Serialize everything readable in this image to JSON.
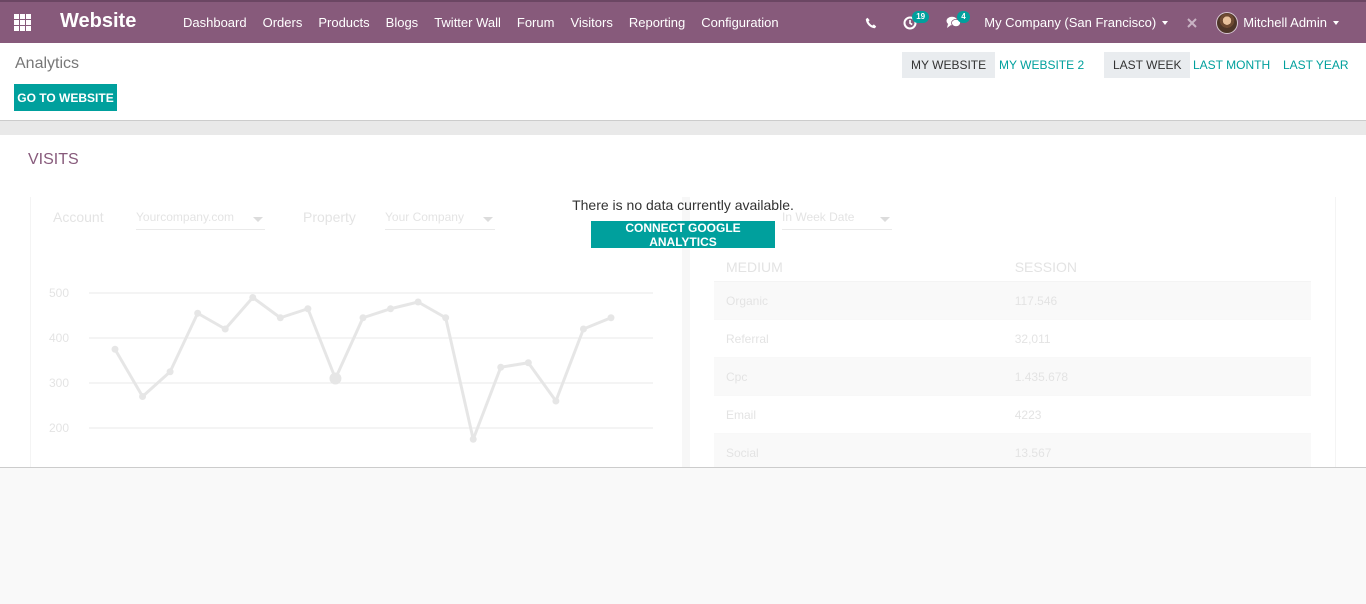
{
  "topbar": {
    "brand": "Website",
    "menu": [
      "Dashboard",
      "Orders",
      "Products",
      "Blogs",
      "Twitter Wall",
      "Forum",
      "Visitors",
      "Reporting",
      "Configuration"
    ],
    "activity_count": "19",
    "message_count": "4",
    "company": "My Company (San Francisco)",
    "user": "Mitchell Admin"
  },
  "control_panel": {
    "title": "Analytics",
    "go_to_website": "GO TO WEBSITE",
    "websites": [
      "MY WEBSITE",
      "MY WEBSITE 2"
    ],
    "periods": [
      "LAST WEEK",
      "LAST MONTH",
      "LAST YEAR"
    ]
  },
  "visits": {
    "title": "VISITS",
    "no_data_message": "There is no data currently available.",
    "connect_button": "CONNECT GOOGLE ANALYTICS",
    "filters": {
      "account_label": "Account",
      "account_value": "Yourcompany.com",
      "property_label": "Property",
      "property_value": "Your Company",
      "date_value": "In Week Date"
    },
    "table": {
      "headers": [
        "MEDIUM",
        "SESSION"
      ],
      "rows": [
        [
          "Organic",
          "117.546"
        ],
        [
          "Referral",
          "32,011"
        ],
        [
          "Cpc",
          "1.435.678"
        ],
        [
          "Email",
          "4223"
        ],
        [
          "Social",
          "13.567"
        ]
      ]
    }
  },
  "chart_data": {
    "type": "line",
    "yticks": [
      500,
      400,
      300,
      200
    ],
    "ylim": [
      160,
      520
    ],
    "values": [
      375,
      270,
      325,
      455,
      420,
      490,
      445,
      465,
      310,
      445,
      465,
      480,
      445,
      175,
      335,
      345,
      260,
      420,
      445
    ],
    "highlight_index": 8,
    "grid": true
  }
}
